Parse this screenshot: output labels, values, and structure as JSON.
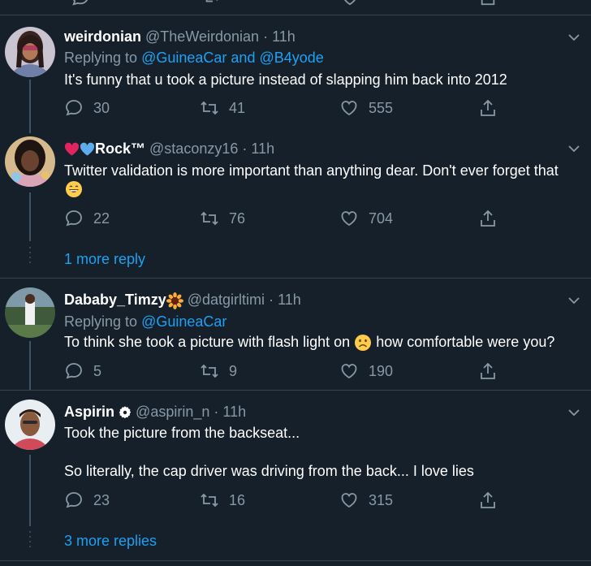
{
  "tweets": [
    {
      "name": "weirdonian",
      "handle": "@TheWeirdonian",
      "time": "11h",
      "replying_label": "Replying to",
      "mentions": [
        "@GuineaCar",
        "and",
        "@B4yode"
      ],
      "text": "It's funny that u took a picture instead of slapping him back into 2012",
      "replies": "30",
      "retweets": "41",
      "likes": "555"
    },
    {
      "name": "Rock™",
      "handle": "@staconzy16",
      "time": "11h",
      "text": "Twitter validation is more important than anything dear. Don't ever forget that",
      "replies": "22",
      "retweets": "76",
      "likes": "704"
    },
    {
      "name": "Dababy_Timzy",
      "handle": "@datgirltimi",
      "time": "11h",
      "replying_label": "Replying to",
      "mentions": [
        "@GuineaCar"
      ],
      "text_before": "To think she took a picture with flash light on",
      "text_after": "how comfortable were you?",
      "replies": "5",
      "retweets": "9",
      "likes": "190"
    },
    {
      "name": "Aspirin",
      "handle": "@aspirin_n",
      "time": "11h",
      "text_line1": "Took the picture from the backseat...",
      "text_line2": "So literally, the cap driver was driving from the back... I love lies",
      "replies": "23",
      "retweets": "16",
      "likes": "315"
    }
  ],
  "more_links": {
    "first": "1 more reply",
    "second": "3 more replies"
  },
  "colors": {
    "background": "#15202b",
    "secondary_text": "#8899a6",
    "link": "#1da1f2",
    "separator": "#38444d"
  },
  "icons": [
    "reply-icon",
    "retweet-icon",
    "like-icon",
    "share-icon",
    "chevron-down-icon",
    "heart-emoji",
    "blue-heart-emoji",
    "grinning-emoji",
    "frowning-emoji",
    "sunflower-emoji",
    "verified-badge-icon"
  ]
}
